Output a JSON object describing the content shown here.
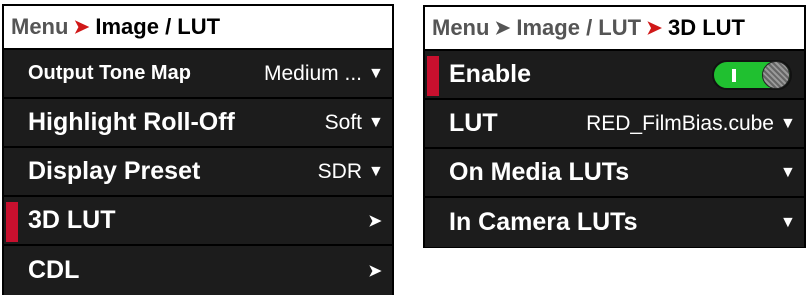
{
  "left_panel": {
    "breadcrumb": {
      "menu": "Menu",
      "current": "Image / LUT"
    },
    "rows": [
      {
        "label": "Output Tone Map",
        "value": "Medium ...",
        "control": "chevron-down"
      },
      {
        "label": "Highlight Roll-Off",
        "value": "Soft",
        "control": "chevron-down"
      },
      {
        "label": "Display Preset",
        "value": "SDR",
        "control": "chevron-down"
      },
      {
        "label": "3D LUT",
        "value": "",
        "control": "arrow-right",
        "selected": true
      },
      {
        "label": "CDL",
        "value": "",
        "control": "arrow-right"
      }
    ]
  },
  "right_panel": {
    "breadcrumb": {
      "menu": "Menu",
      "section": "Image / LUT",
      "current": "3D LUT"
    },
    "rows": [
      {
        "label": "Enable",
        "control": "toggle",
        "toggle_on": true,
        "selected": true
      },
      {
        "label": "LUT",
        "value": "RED_FilmBias.cube",
        "control": "chevron-down"
      },
      {
        "label": "On Media LUTs",
        "value": "",
        "control": "chevron-down"
      },
      {
        "label": "In Camera LUTs",
        "value": "",
        "control": "chevron-down"
      }
    ]
  },
  "icons": {
    "separator_active": "arrow-right-red",
    "separator_inactive": "arrow-right-gray",
    "chevron": "chevron-down-icon",
    "arrow": "arrow-right-icon"
  },
  "colors": {
    "selection_bar": "#c8102e",
    "separator_active": "#d01818",
    "toggle_on": "#20c030",
    "row_background": "#1c1c1c"
  }
}
